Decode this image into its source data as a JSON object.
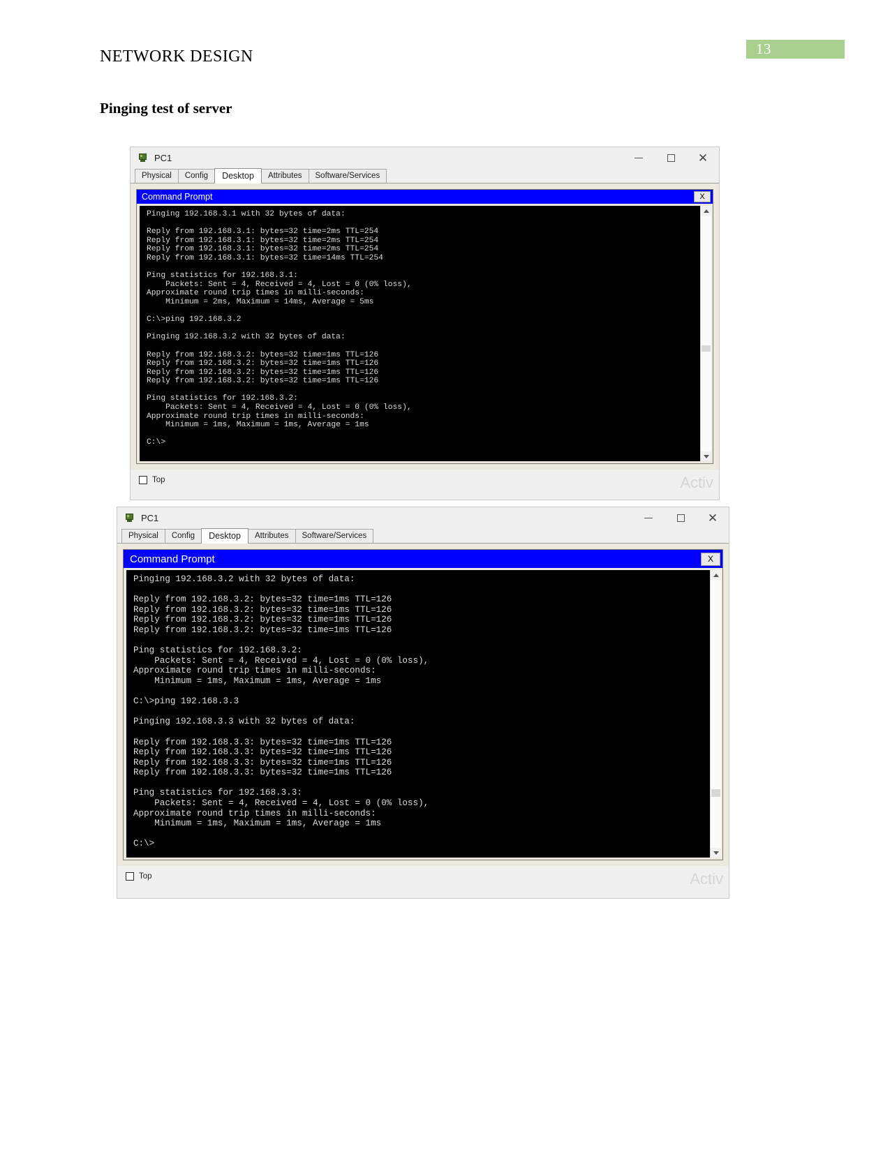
{
  "document": {
    "header_title": "NETWORK DESIGN",
    "page_number": "13",
    "section_title": "Pinging test of server",
    "accent_color": "#a9d08e"
  },
  "windows": [
    {
      "title": "PC1",
      "icon": "pc-device-icon",
      "window_controls": {
        "minimize": "—",
        "maximize": "□",
        "close": "✕"
      },
      "tabs": [
        {
          "label": "Physical",
          "active": false
        },
        {
          "label": "Config",
          "active": false
        },
        {
          "label": "Desktop",
          "active": true
        },
        {
          "label": "Attributes",
          "active": false
        },
        {
          "label": "Software/Services",
          "active": false
        }
      ],
      "command_prompt": {
        "title": "Command Prompt",
        "close_label": "X",
        "terminal_text": "Pinging 192.168.3.1 with 32 bytes of data:\n\nReply from 192.168.3.1: bytes=32 time=2ms TTL=254\nReply from 192.168.3.1: bytes=32 time=2ms TTL=254\nReply from 192.168.3.1: bytes=32 time=2ms TTL=254\nReply from 192.168.3.1: bytes=32 time=14ms TTL=254\n\nPing statistics for 192.168.3.1:\n    Packets: Sent = 4, Received = 4, Lost = 0 (0% loss),\nApproximate round trip times in milli-seconds:\n    Minimum = 2ms, Maximum = 14ms, Average = 5ms\n\nC:\\>ping 192.168.3.2\n\nPinging 192.168.3.2 with 32 bytes of data:\n\nReply from 192.168.3.2: bytes=32 time=1ms TTL=126\nReply from 192.168.3.2: bytes=32 time=1ms TTL=126\nReply from 192.168.3.2: bytes=32 time=1ms TTL=126\nReply from 192.168.3.2: bytes=32 time=1ms TTL=126\n\nPing statistics for 192.168.3.2:\n    Packets: Sent = 4, Received = 4, Lost = 0 (0% loss),\nApproximate round trip times in milli-seconds:\n    Minimum = 1ms, Maximum = 1ms, Average = 1ms\n\nC:\\>"
      },
      "footer": {
        "checkbox_label": "Top",
        "checkbox_checked": false,
        "watermark": "Activ"
      }
    },
    {
      "title": "PC1",
      "icon": "pc-device-icon",
      "window_controls": {
        "minimize": "—",
        "maximize": "□",
        "close": "✕"
      },
      "tabs": [
        {
          "label": "Physical",
          "active": false
        },
        {
          "label": "Config",
          "active": false
        },
        {
          "label": "Desktop",
          "active": true
        },
        {
          "label": "Attributes",
          "active": false
        },
        {
          "label": "Software/Services",
          "active": false
        }
      ],
      "command_prompt": {
        "title": "Command Prompt",
        "close_label": "X",
        "terminal_text": "Pinging 192.168.3.2 with 32 bytes of data:\n\nReply from 192.168.3.2: bytes=32 time=1ms TTL=126\nReply from 192.168.3.2: bytes=32 time=1ms TTL=126\nReply from 192.168.3.2: bytes=32 time=1ms TTL=126\nReply from 192.168.3.2: bytes=32 time=1ms TTL=126\n\nPing statistics for 192.168.3.2:\n    Packets: Sent = 4, Received = 4, Lost = 0 (0% loss),\nApproximate round trip times in milli-seconds:\n    Minimum = 1ms, Maximum = 1ms, Average = 1ms\n\nC:\\>ping 192.168.3.3\n\nPinging 192.168.3.3 with 32 bytes of data:\n\nReply from 192.168.3.3: bytes=32 time=1ms TTL=126\nReply from 192.168.3.3: bytes=32 time=1ms TTL=126\nReply from 192.168.3.3: bytes=32 time=1ms TTL=126\nReply from 192.168.3.3: bytes=32 time=1ms TTL=126\n\nPing statistics for 192.168.3.3:\n    Packets: Sent = 4, Received = 4, Lost = 0 (0% loss),\nApproximate round trip times in milli-seconds:\n    Minimum = 1ms, Maximum = 1ms, Average = 1ms\n\nC:\\>"
      },
      "footer": {
        "checkbox_label": "Top",
        "checkbox_checked": false,
        "watermark": "Activ"
      }
    }
  ]
}
